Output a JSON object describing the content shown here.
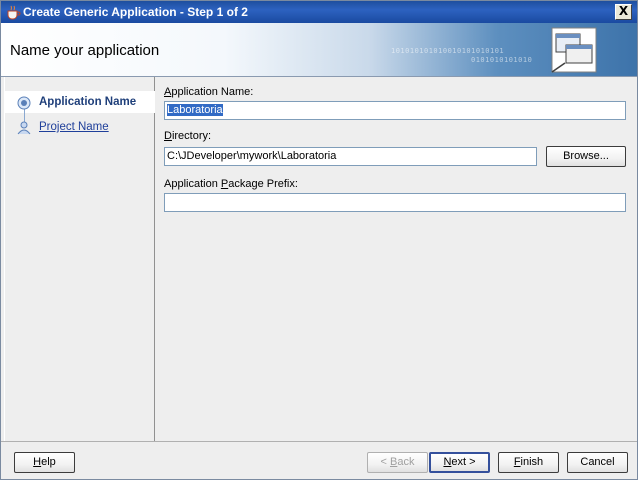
{
  "window": {
    "title": "Create Generic Application - Step 1 of 2",
    "close_label": "X"
  },
  "banner": {
    "title": "Name your application",
    "binary_1": "101010101010010101010101",
    "binary_2": "0101010101010"
  },
  "steps": [
    {
      "label": "Application Name",
      "active": true
    },
    {
      "label": "Project Name",
      "active": false
    }
  ],
  "form": {
    "app_name": {
      "mnemonic": "A",
      "label_rest": "pplication Name:",
      "value": "Laboratoria"
    },
    "directory": {
      "mnemonic": "D",
      "label_rest": "irectory:",
      "value": "C:\\JDeveloper\\mywork\\Laboratoria"
    },
    "package_prefix": {
      "label_pre": "Application ",
      "mnemonic": "P",
      "label_rest": "ackage Prefix:",
      "value": ""
    },
    "browse": {
      "label": "Browse..."
    }
  },
  "buttons": {
    "help": {
      "mnemonic": "H",
      "rest": "elp"
    },
    "back": {
      "pre": "< ",
      "mnemonic": "B",
      "rest": "ack"
    },
    "next": {
      "mnemonic": "N",
      "rest": "ext >"
    },
    "finish": {
      "mnemonic": "F",
      "rest": "inish"
    },
    "cancel": {
      "label": "Cancel"
    }
  },
  "colors": {
    "title_bar": "#2d62c0",
    "active_step": "#1f3f7a",
    "selection": "#316ac5"
  }
}
